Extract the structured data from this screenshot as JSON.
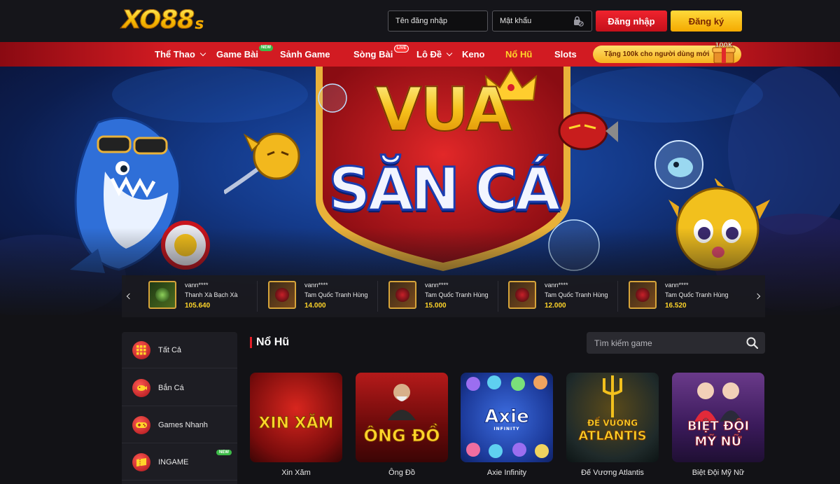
{
  "header": {
    "logo_main": "XO88",
    "logo_suffix": "s",
    "username_placeholder": "Tên đăng nhập",
    "password_placeholder": "Mật khẩu",
    "login_label": "Đăng nhập",
    "register_label": "Đăng ký"
  },
  "nav": {
    "items": [
      {
        "label": "Thể Thao",
        "dropdown": true
      },
      {
        "label": "Game Bài",
        "badge": "NEW"
      },
      {
        "label": "Sảnh Game"
      },
      {
        "label": "Sòng Bài",
        "badge": "LIVE"
      },
      {
        "label": "Lô Đề",
        "dropdown": true
      },
      {
        "label": "Keno"
      },
      {
        "label": "Nổ Hũ",
        "active": true
      },
      {
        "label": "Slots"
      }
    ],
    "promo_label": "Tặng 100k cho người dùng mới",
    "promo_gift_label": "100K"
  },
  "banner": {
    "line1": "VUA",
    "line2": "SĂN CÁ"
  },
  "winners": [
    {
      "user": "vann****",
      "game": "Thanh Xà Bạch Xà",
      "amount": "105.640"
    },
    {
      "user": "vann****",
      "game": "Tam Quốc Tranh Hùng",
      "amount": "14.000"
    },
    {
      "user": "vann****",
      "game": "Tam Quốc Tranh Hùng",
      "amount": "15.000"
    },
    {
      "user": "vann****",
      "game": "Tam Quốc Tranh Hùng",
      "amount": "12.000"
    },
    {
      "user": "vann****",
      "game": "Tam Quốc Tranh Hùng",
      "amount": "16.520"
    }
  ],
  "sidebar": {
    "items": [
      {
        "label": "Tất Cả"
      },
      {
        "label": "Bắn Cá"
      },
      {
        "label": "Games Nhanh"
      },
      {
        "label": "INGAME",
        "badge": "NEW"
      }
    ]
  },
  "main": {
    "section_title": "Nổ Hũ",
    "search_placeholder": "Tìm kiếm game",
    "games": [
      {
        "name": "Xin Xăm",
        "logo": "XIN XĂM"
      },
      {
        "name": "Ông Đồ",
        "logo": "ÔNG ĐỒ"
      },
      {
        "name": "Axie Infinity",
        "logo": "Axie",
        "logo_sub": "INFINITY"
      },
      {
        "name": "Đế Vương Atlantis",
        "logo": "ĐẾ VƯƠNG",
        "logo_sub": "ATLANTIS"
      },
      {
        "name": "Biệt Đội Mỹ Nữ",
        "logo": "BIỆT ĐỘI",
        "logo_sub": "MỸ NỮ"
      }
    ]
  },
  "colors": {
    "nav_red": "#d21b22",
    "accent_yellow": "#ffd52a",
    "login_red": "#e01f28",
    "register_yellow": "#f7c21d",
    "page_bg": "#121216"
  }
}
